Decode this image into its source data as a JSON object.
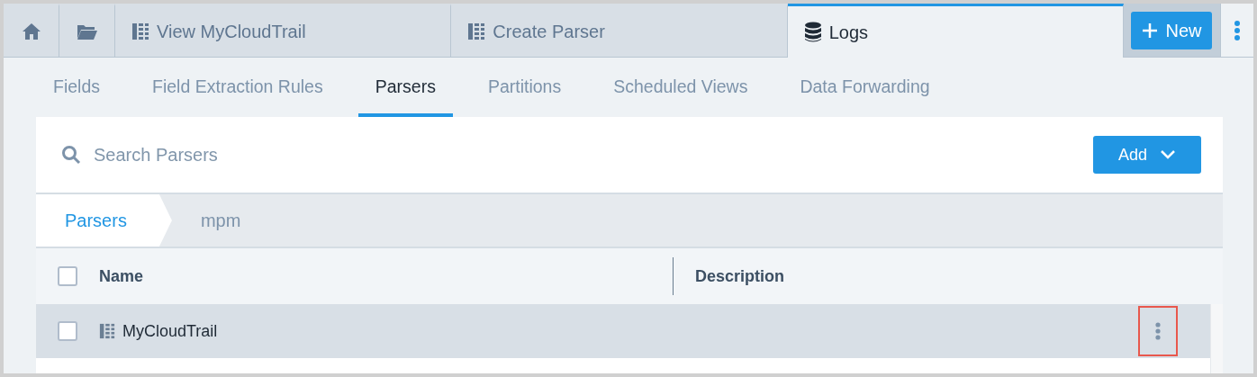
{
  "top_tabs": [
    {
      "kind": "home",
      "selected": false
    },
    {
      "kind": "folder",
      "selected": false
    },
    {
      "kind": "parser",
      "label": "View MyCloudTrail",
      "selected": false
    },
    {
      "kind": "parser",
      "label": "Create Parser",
      "selected": false
    },
    {
      "kind": "database",
      "label": "Logs",
      "selected": true
    }
  ],
  "new_button": {
    "label": "New"
  },
  "sub_tabs": [
    {
      "label": "Fields",
      "selected": false
    },
    {
      "label": "Field Extraction Rules",
      "selected": false
    },
    {
      "label": "Parsers",
      "selected": true
    },
    {
      "label": "Partitions",
      "selected": false
    },
    {
      "label": "Scheduled Views",
      "selected": false
    },
    {
      "label": "Data Forwarding",
      "selected": false
    }
  ],
  "search": {
    "placeholder": "Search Parsers"
  },
  "add_button": {
    "label": "Add"
  },
  "breadcrumb": [
    {
      "label": "Parsers",
      "selected": true
    },
    {
      "label": "mpm",
      "selected": false
    }
  ],
  "table": {
    "all_checked": false,
    "columns": [
      "Name",
      "Description"
    ],
    "rows": [
      {
        "name": "MyCloudTrail",
        "checked": false,
        "selected": true,
        "menu_highlighted": true
      }
    ]
  }
}
